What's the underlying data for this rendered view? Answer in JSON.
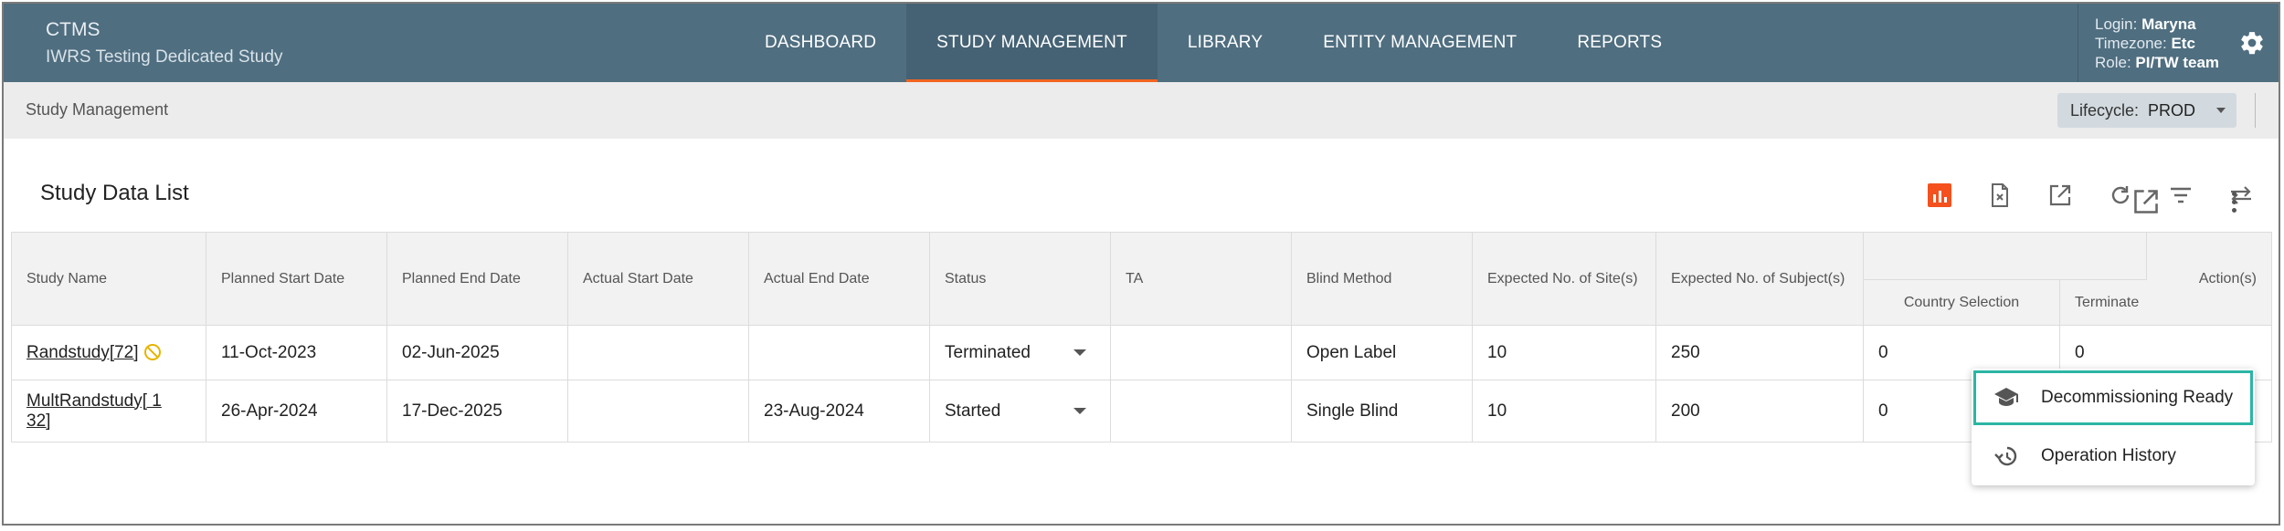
{
  "app": {
    "name": "CTMS",
    "study": "IWRS Testing Dedicated Study"
  },
  "nav": [
    {
      "label": "DASHBOARD",
      "active": false
    },
    {
      "label": "STUDY MANAGEMENT",
      "active": true
    },
    {
      "label": "LIBRARY",
      "active": false
    },
    {
      "label": "ENTITY MANAGEMENT",
      "active": false
    },
    {
      "label": "REPORTS",
      "active": false
    }
  ],
  "user": {
    "login_label": "Login:",
    "login": "Maryna",
    "timezone_label": "Timezone:",
    "timezone": "Etc",
    "role_label": "Role:",
    "role": "PI/TW team"
  },
  "breadcrumb": "Study Management",
  "lifecycle": {
    "label": "Lifecycle:",
    "value": "PROD"
  },
  "card": {
    "title": "Study Data List"
  },
  "toolbar_icons": [
    "chart-icon",
    "export-file-icon",
    "open-external-icon",
    "refresh-icon",
    "filter-icon",
    "swap-icon"
  ],
  "table": {
    "headers": {
      "study_name": "Study Name",
      "planned_start": "Planned Start Date",
      "planned_end": "Planned End Date",
      "actual_start": "Actual Start Date",
      "actual_end": "Actual End Date",
      "status": "Status",
      "ta": "TA",
      "blind": "Blind Method",
      "sites": "Expected No. of Site(s)",
      "subjects": "Expected No. of Subject(s)",
      "country": "Country Selection",
      "terminate": "Terminate",
      "actions": "Action(s)"
    },
    "rows": [
      {
        "study_name": "Randstudy[72]",
        "planned_start": "11-Oct-2023",
        "planned_end": "02-Jun-2025",
        "actual_start": "",
        "actual_end": "",
        "status": "Terminated",
        "ta": "",
        "blind": "Open Label",
        "sites": "10",
        "subjects": "250",
        "country": "0",
        "terminate": "0"
      },
      {
        "study_name": "MultRandstudy[ 132]",
        "planned_start": "26-Apr-2024",
        "planned_end": "17-Dec-2025",
        "actual_start": "",
        "actual_end": "23-Aug-2024",
        "status": "Started",
        "ta": "",
        "blind": "Single Blind",
        "sites": "10",
        "subjects": "200",
        "country": "0",
        "terminate": ""
      }
    ]
  },
  "menu": [
    {
      "label": "Decommissioning Ready",
      "icon": "graduation-cap-icon",
      "highlighted": true
    },
    {
      "label": "Operation History",
      "icon": "history-icon",
      "highlighted": false
    }
  ],
  "colors": {
    "header": "#4f6e80",
    "accent": "#f26522",
    "highlight": "#2bb5a4",
    "chart_button": "#f4511e"
  }
}
